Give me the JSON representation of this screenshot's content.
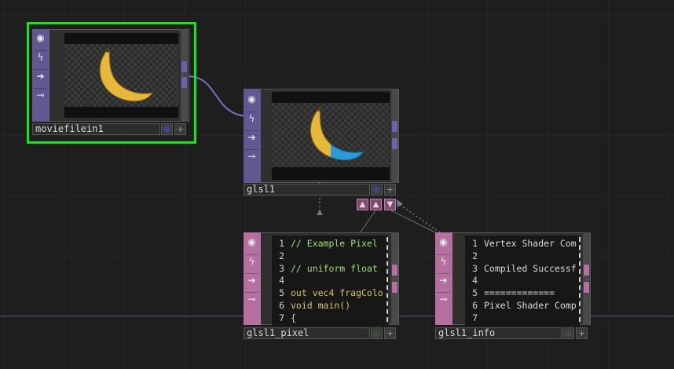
{
  "nodes": {
    "moviefilein": {
      "name": "moviefilein1",
      "selected": true,
      "icons": [
        "viewer-icon",
        "bypass-icon",
        "cook-icon",
        "lock-icon"
      ]
    },
    "glsl": {
      "name": "glsl1",
      "icons": [
        "viewer-icon",
        "bypass-icon",
        "cook-icon",
        "lock-icon"
      ]
    },
    "glsl_pixel": {
      "name": "glsl1_pixel",
      "lines": [
        {
          "n": "1",
          "text": "// Example Pixel",
          "color": "#9ee07a"
        },
        {
          "n": "2",
          "text": "",
          "color": "#cfcfcf"
        },
        {
          "n": "3",
          "text": "// uniform float",
          "color": "#9ee07a"
        },
        {
          "n": "4",
          "text": "",
          "color": "#cfcfcf"
        },
        {
          "n": "5",
          "text": "out vec4 fragColo",
          "color": "#d9c46a"
        },
        {
          "n": "6",
          "text": "void main()",
          "color": "#d9c46a"
        },
        {
          "n": "7",
          "text": "{",
          "color": "#cfcfcf"
        }
      ]
    },
    "glsl_info": {
      "name": "glsl1_info",
      "lines": [
        {
          "n": "1",
          "text": "Vertex Shader Com"
        },
        {
          "n": "2",
          "text": ""
        },
        {
          "n": "3",
          "text": "Compiled Successf"
        },
        {
          "n": "4",
          "text": ""
        },
        {
          "n": "5",
          "text": "============="
        },
        {
          "n": "6",
          "text": "Pixel Shader Comp"
        },
        {
          "n": "7",
          "text": ""
        }
      ]
    }
  },
  "glyphs": {
    "viewer": "◉",
    "bypass": "ϟ",
    "cook": "➔",
    "lock": "⊸",
    "plus": "+",
    "up": "▲",
    "down": "▼"
  },
  "colors": {
    "background": "#1e1e1e",
    "top_strip": "#5f5891",
    "dat_strip": "#b5709f",
    "selection": "#19e619",
    "wire": "#7a70c0"
  }
}
